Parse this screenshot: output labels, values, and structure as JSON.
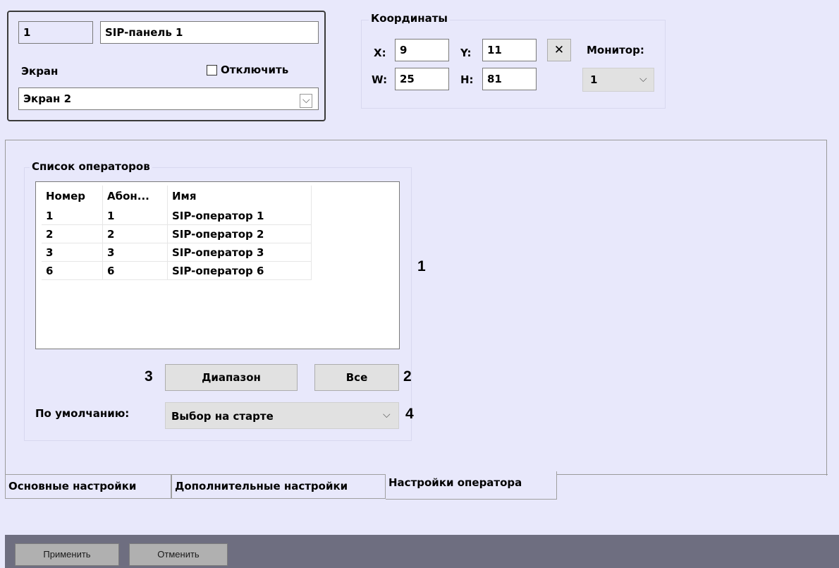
{
  "top_panel": {
    "id_value": "1",
    "name_value": "SIP-панель 1",
    "screen_label": "Экран",
    "disable_label": "Отключить",
    "screen_value": "Экран 2"
  },
  "coords": {
    "title": "Координаты",
    "x_label": "X:",
    "x_value": "9",
    "y_label": "Y:",
    "y_value": "11",
    "w_label": "W:",
    "w_value": "25",
    "h_label": "H:",
    "h_value": "81",
    "clear_label": "✕",
    "monitor_label": "Монитор:",
    "monitor_value": "1"
  },
  "operators": {
    "title": "Список операторов",
    "columns": [
      "Номер",
      "Абон...",
      "Имя"
    ],
    "rows": [
      [
        "1",
        "1",
        "SIP-оператор 1"
      ],
      [
        "2",
        "2",
        "SIP-оператор 2"
      ],
      [
        "3",
        "3",
        "SIP-оператор 3"
      ],
      [
        "6",
        "6",
        "SIP-оператор 6"
      ]
    ],
    "range_button": "Диапазон",
    "all_button": "Все",
    "default_label": "По умолчанию:",
    "default_value": "Выбор на старте"
  },
  "callouts": {
    "c1": "1",
    "c2": "2",
    "c3": "3",
    "c4": "4"
  },
  "tabs": {
    "main": "Основные настройки",
    "extra": "Дополнительные настройки",
    "operator": "Настройки оператора"
  },
  "footer": {
    "apply": "Применить",
    "cancel": "Отменить"
  }
}
